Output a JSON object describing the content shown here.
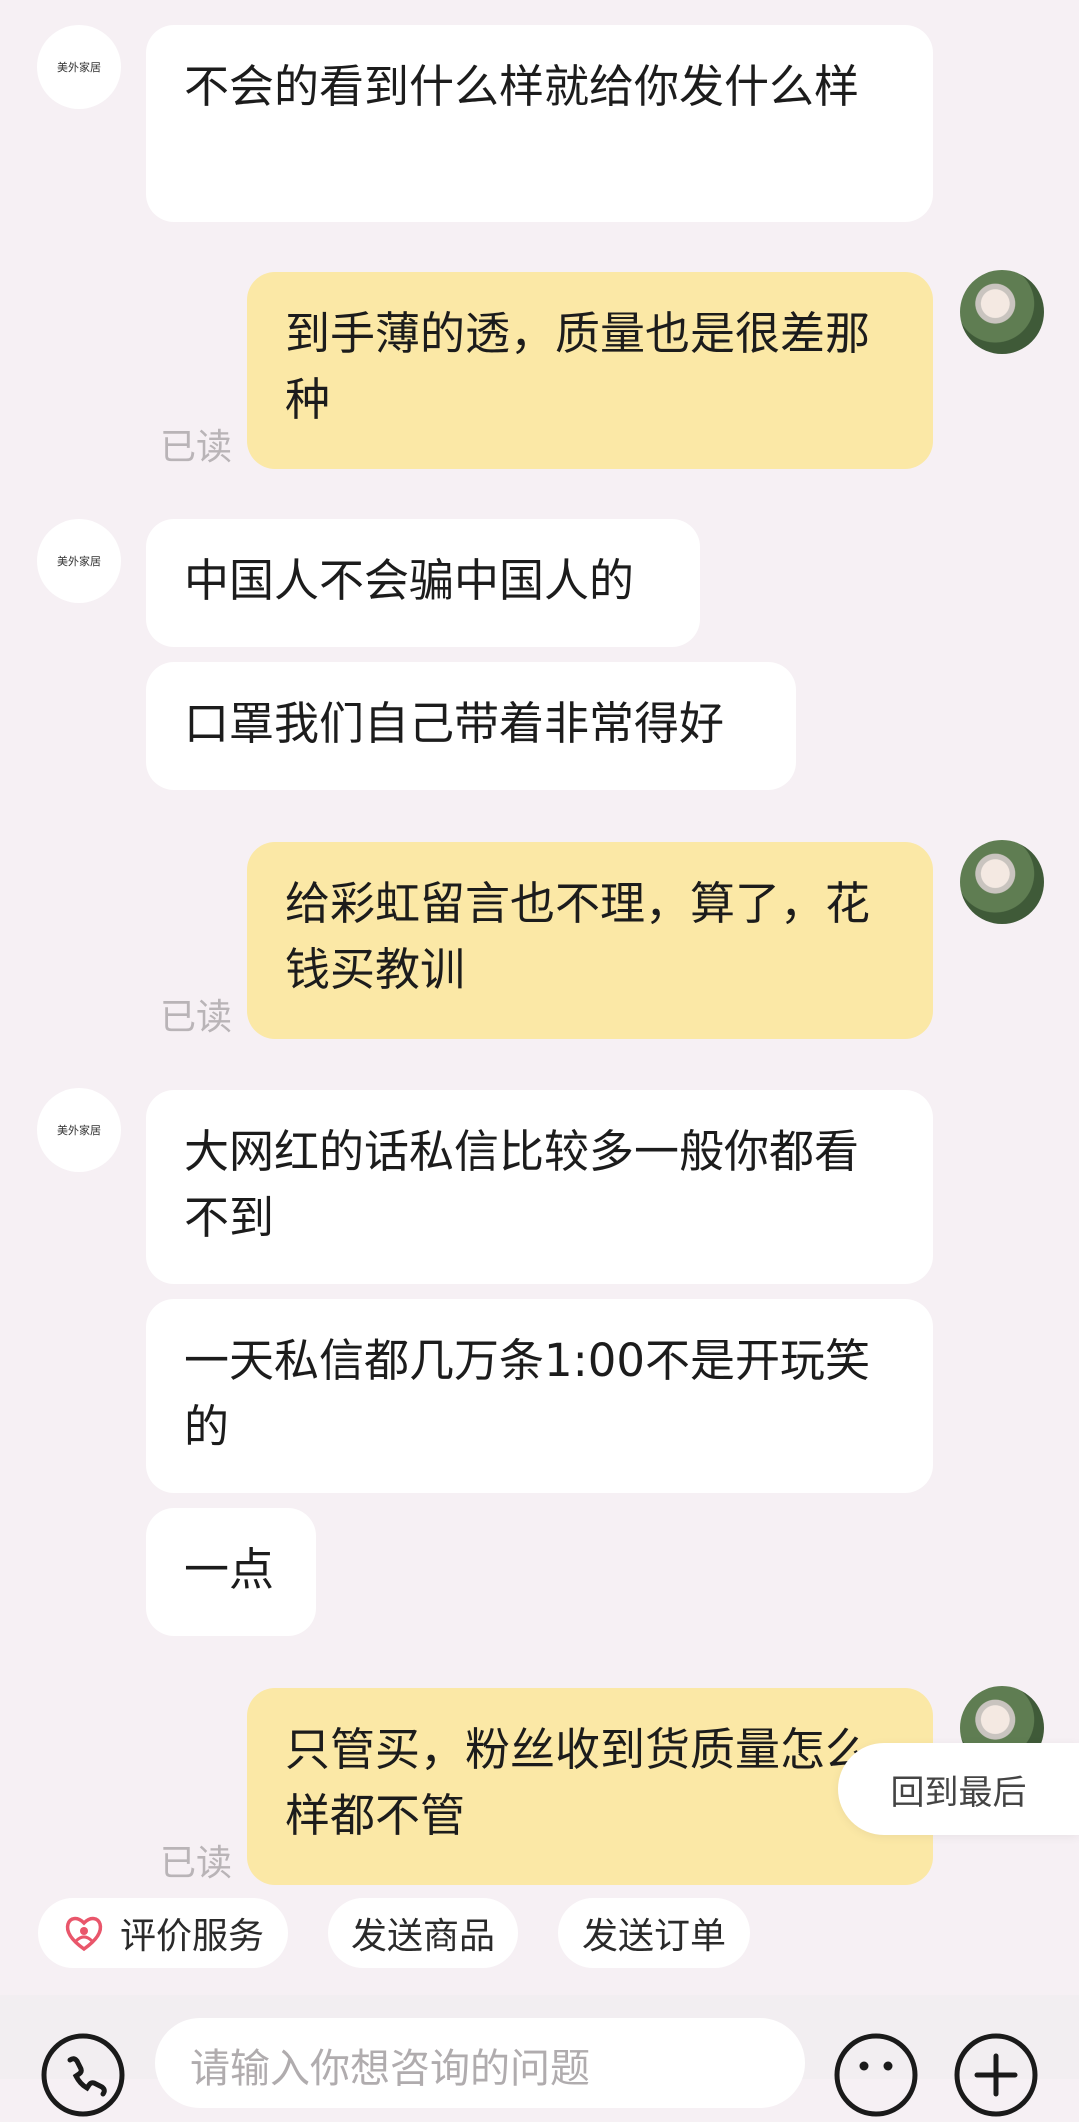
{
  "shop": {
    "avatar_text": "美外家居"
  },
  "messages": [
    {
      "sender": "shop",
      "text": "不会的看到什么样就给你发什么样"
    },
    {
      "sender": "user",
      "text": "到手薄的透，质量也是很差那种",
      "status": "已读"
    },
    {
      "sender": "shop",
      "text": "中国人不会骗中国人的"
    },
    {
      "sender": "shop",
      "text": "口罩我们自己带着非常得好"
    },
    {
      "sender": "user",
      "text": "给彩虹留言也不理，算了，花钱买教训",
      "status": "已读"
    },
    {
      "sender": "shop",
      "text": "大网红的话私信比较多一般你都看不到"
    },
    {
      "sender": "shop",
      "text": "一天私信都几万条1:00不是开玩笑的"
    },
    {
      "sender": "shop",
      "text": "一点"
    },
    {
      "sender": "user",
      "text": "只管买，粉丝收到货质量怎么样都不管",
      "status": "已读"
    }
  ],
  "back_to_latest": "回到最后",
  "quick_actions": [
    {
      "label": "评价服务",
      "icon": "heart-people-icon"
    },
    {
      "label": "发送商品"
    },
    {
      "label": "发送订单"
    }
  ],
  "input": {
    "placeholder": "请输入你想咨询的问题"
  },
  "icons": {
    "phone": "phone-icon",
    "emoji": "emoji-icon",
    "plus": "plus-icon"
  },
  "colors": {
    "incoming_bubble": "#ffffff",
    "outgoing_bubble": "#fbe8a6",
    "background": "#f6f0f4",
    "accent": "#e9566b"
  }
}
